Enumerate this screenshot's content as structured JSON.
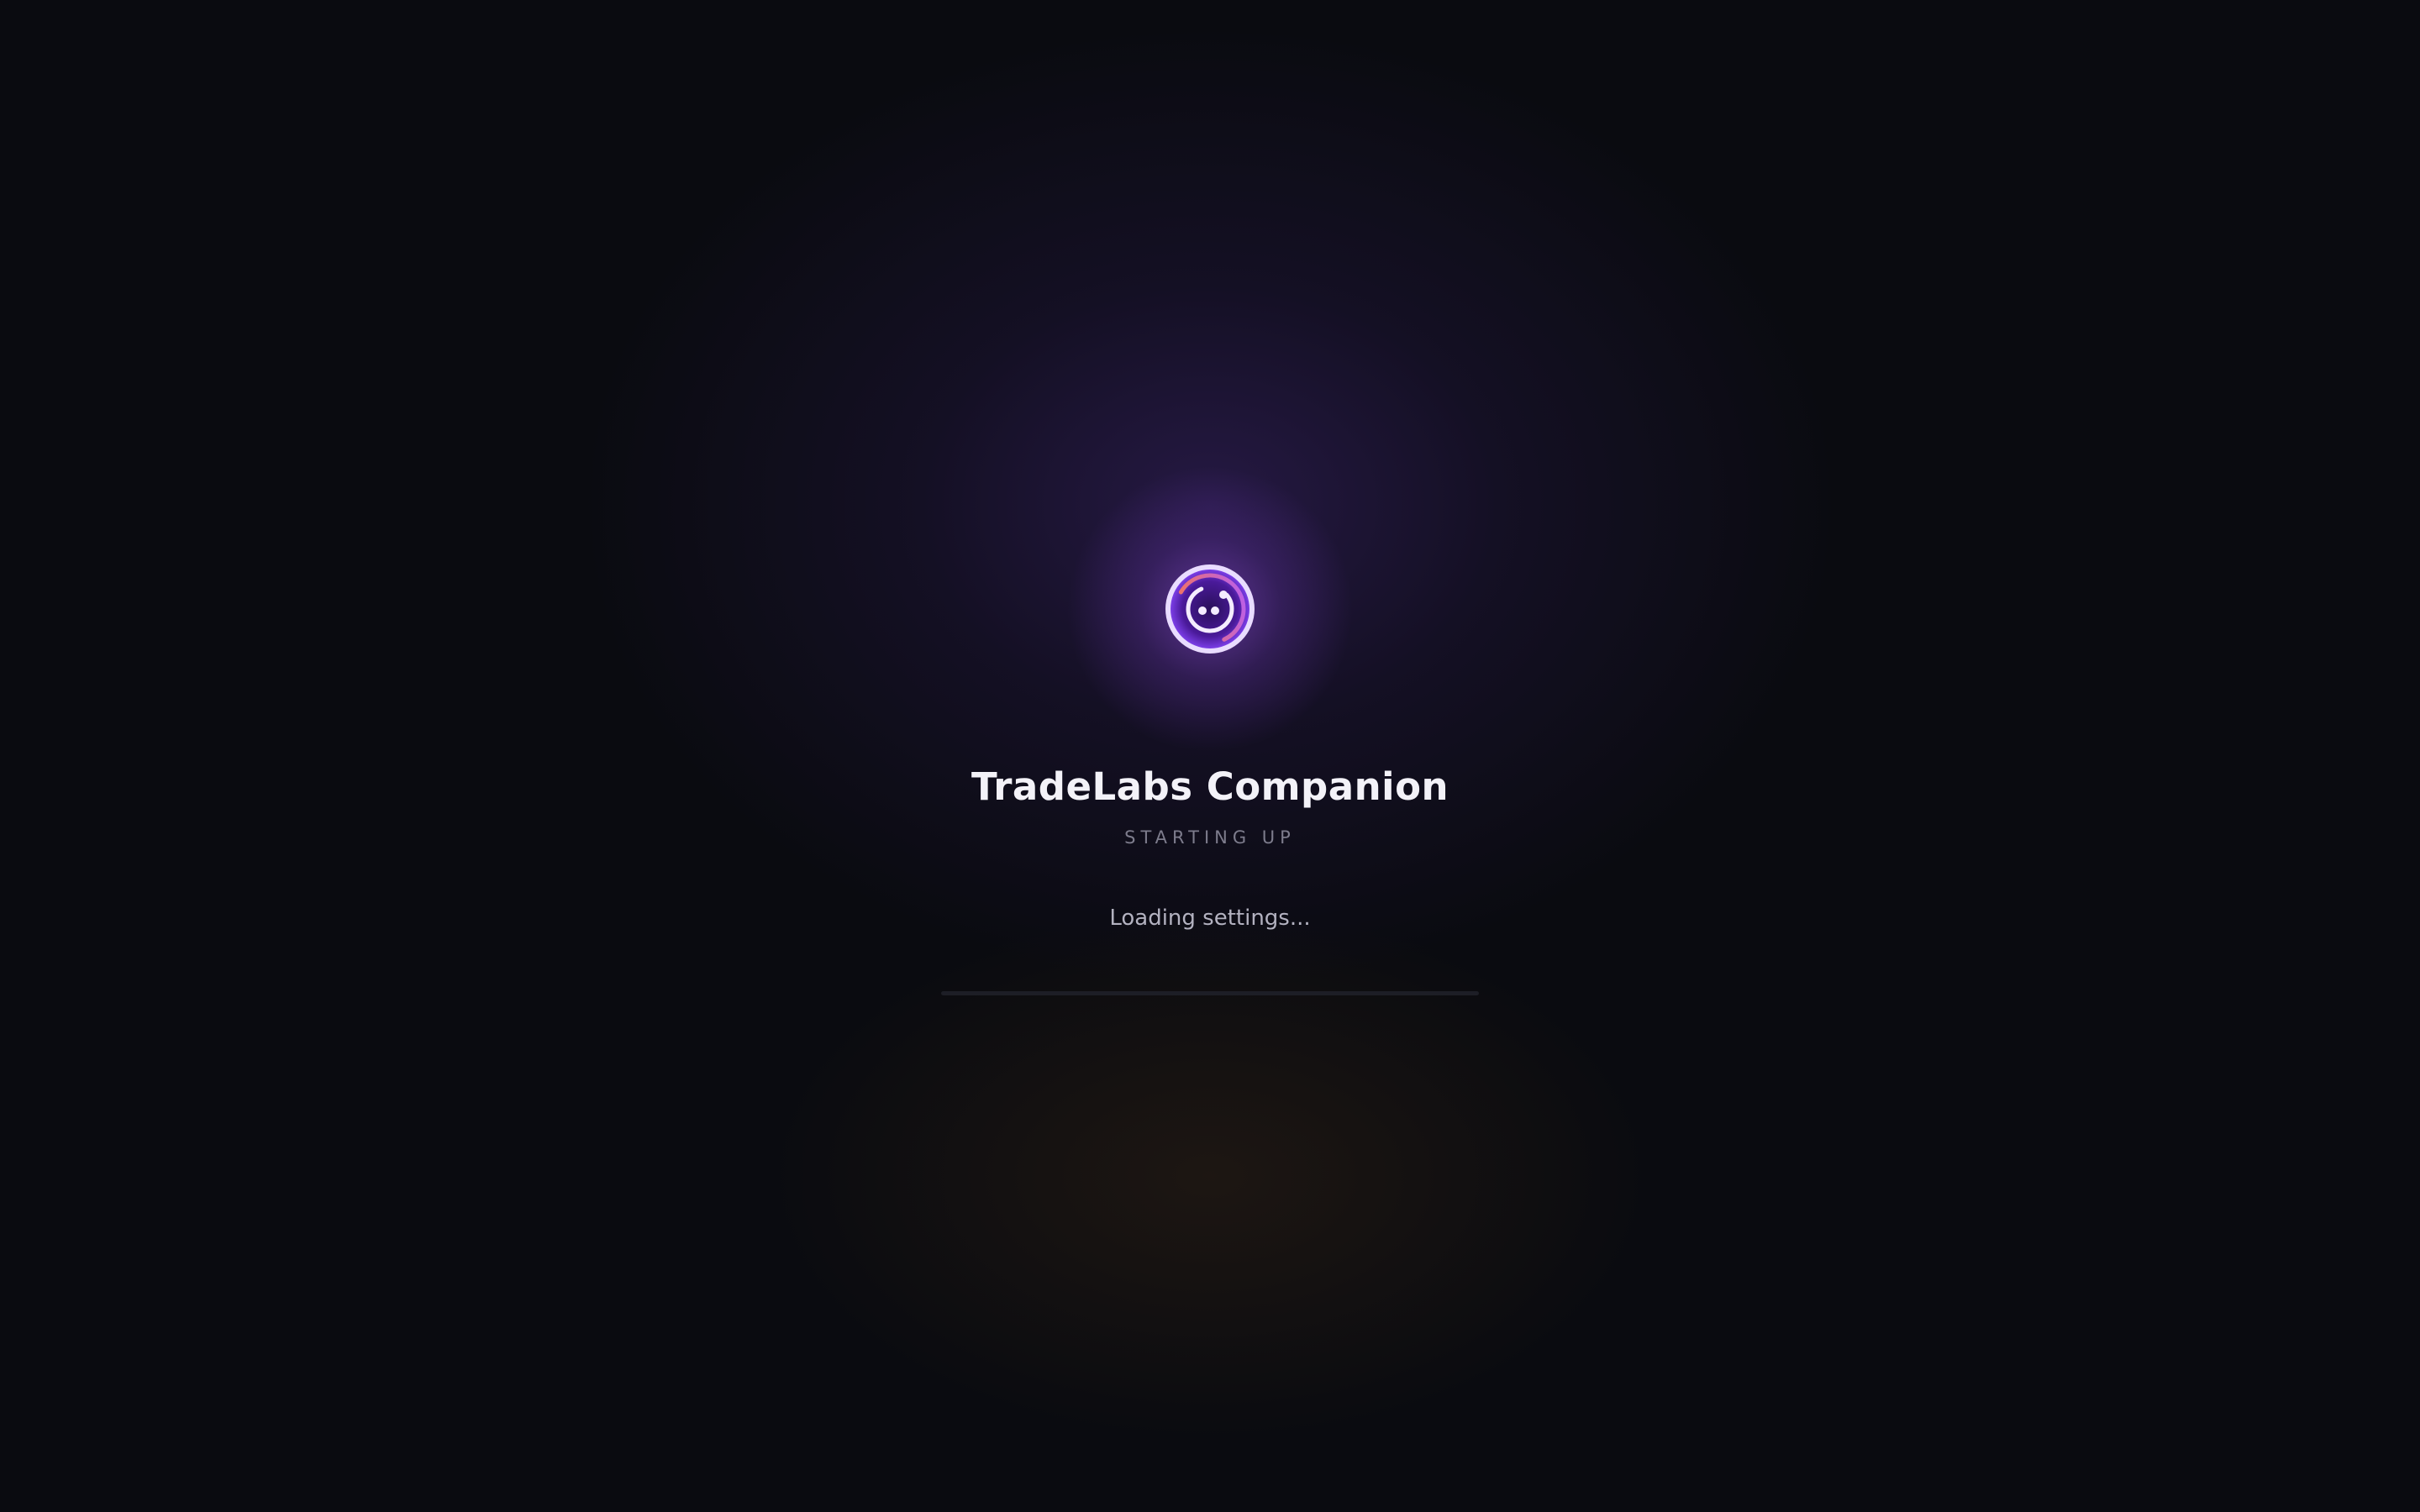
{
  "app": {
    "title": "TradeLabs Companion",
    "subtitle": "STARTING UP",
    "status": "Loading settings..."
  },
  "progress": {
    "fraction": 0
  },
  "logo": {
    "icon": "companion-face-icon"
  },
  "colors": {
    "background": "#0a0b10",
    "accent_purple": "#7a3fe0",
    "accent_orange": "#e0703a",
    "title_text": "#f3f2f8",
    "subtitle_text": "#7d7c8c",
    "status_text": "#b3b2c0"
  }
}
